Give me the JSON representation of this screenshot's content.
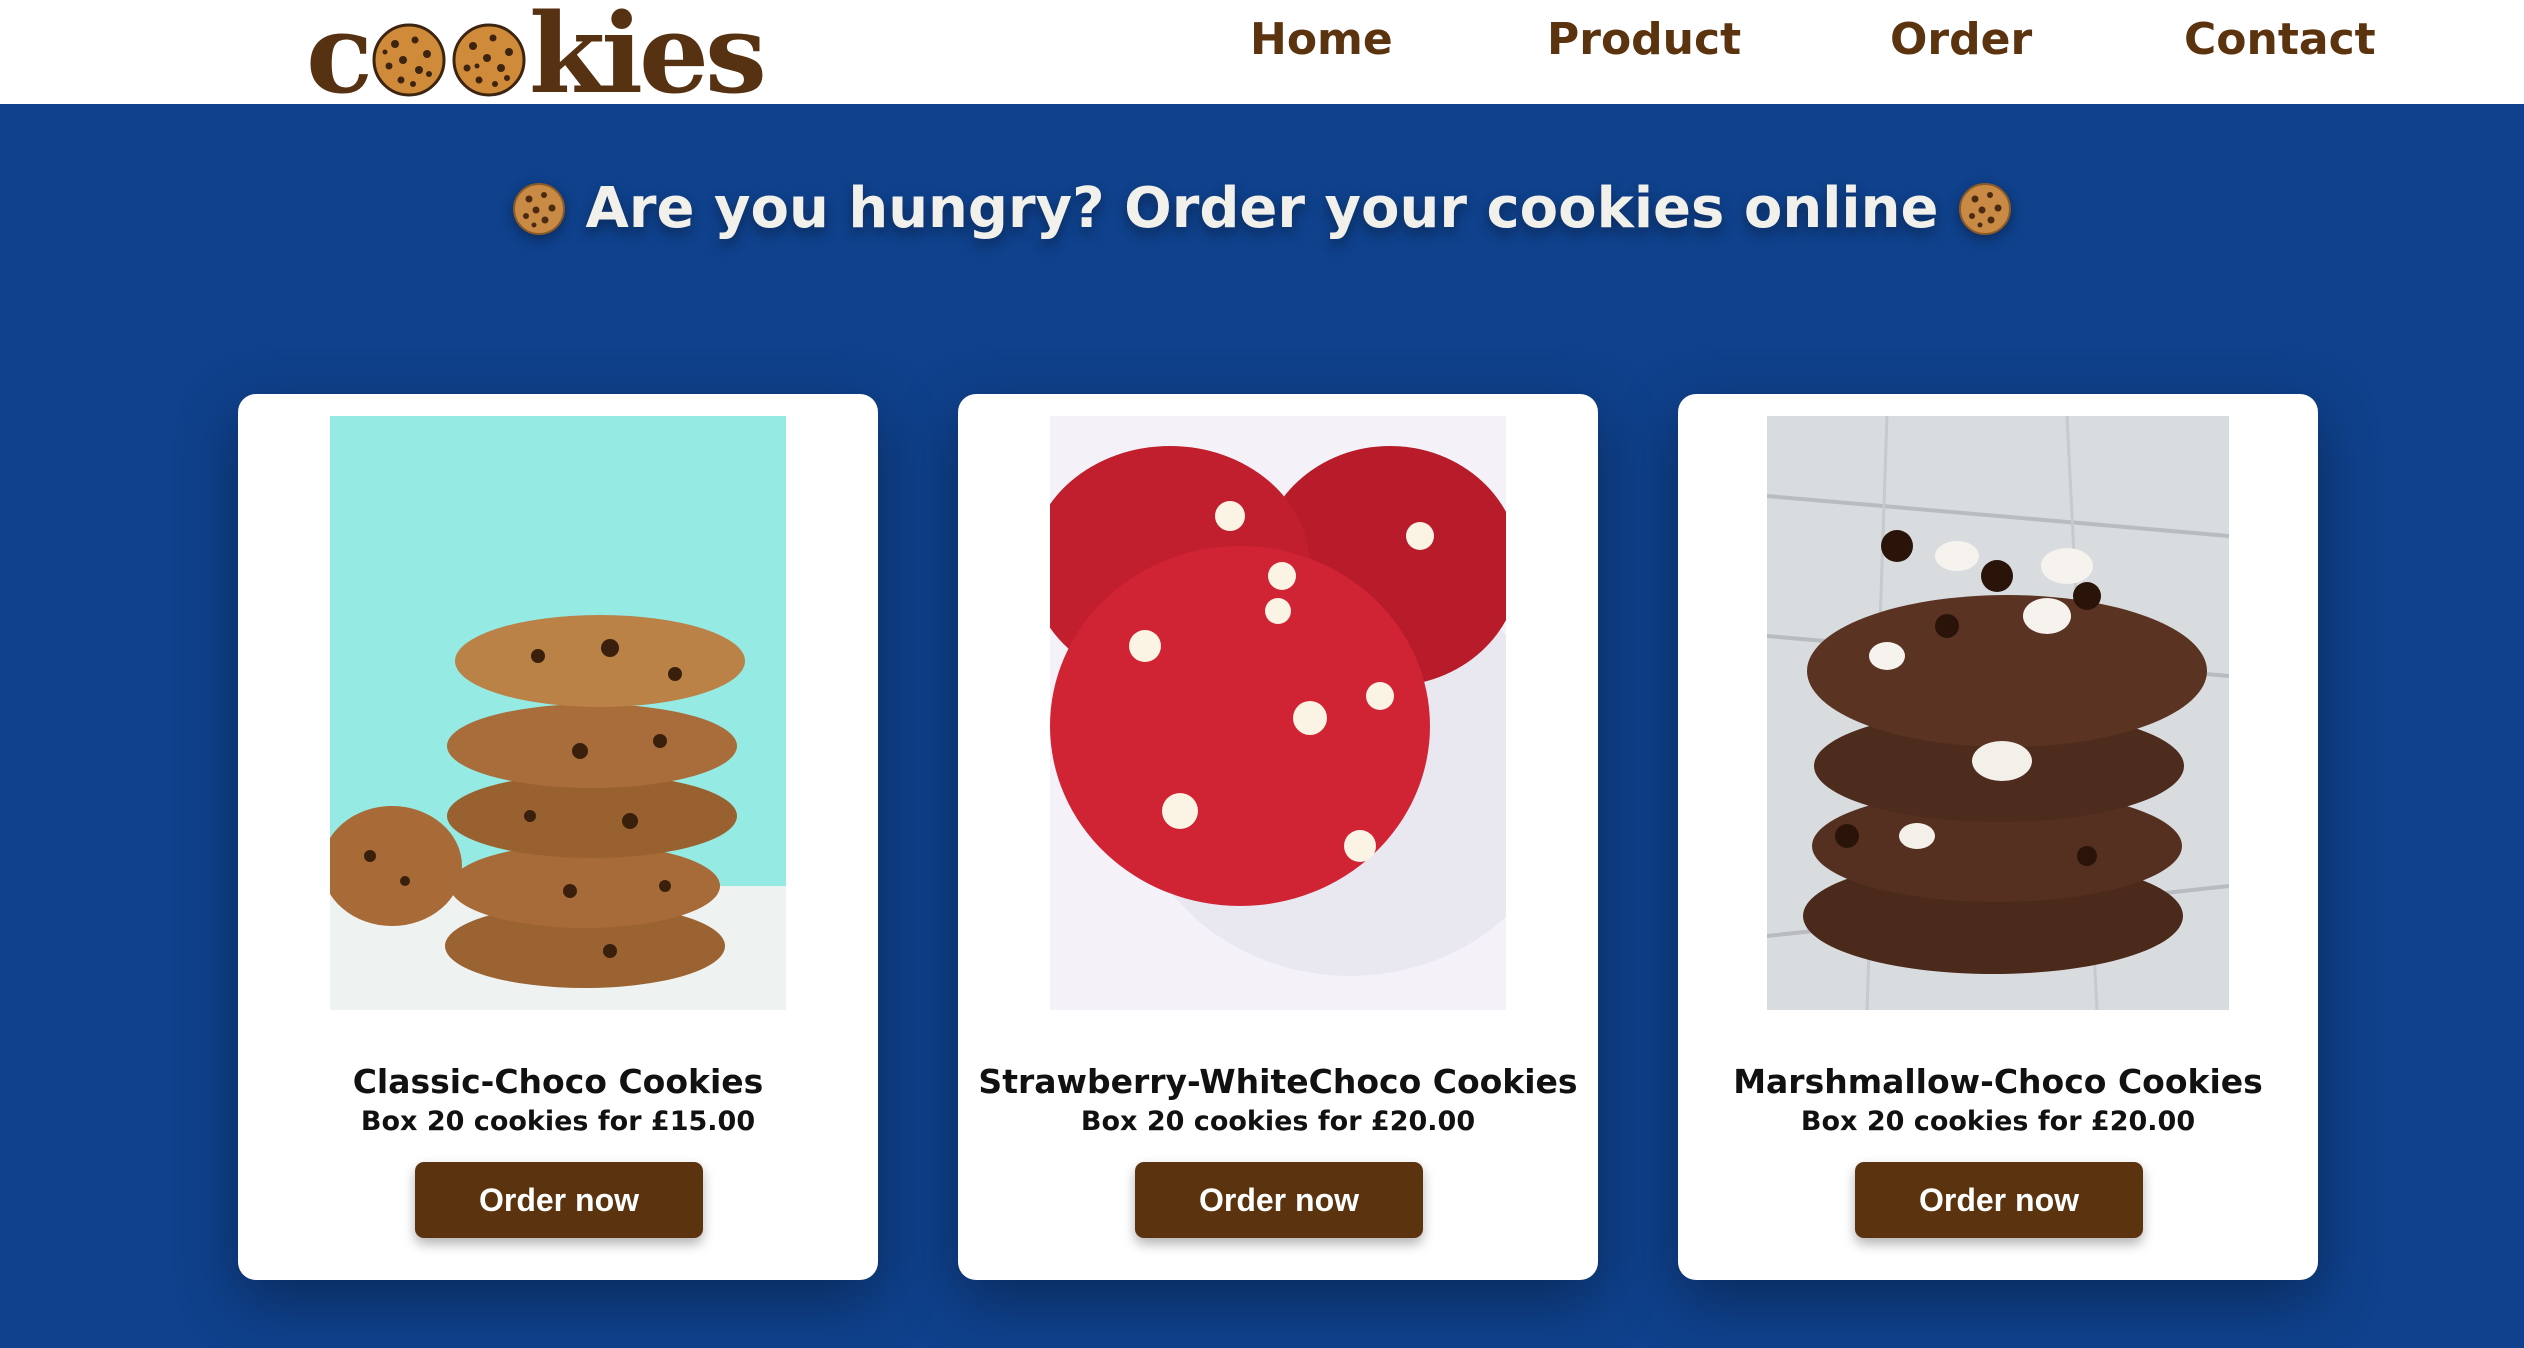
{
  "brand": {
    "logo_text_start": "c",
    "logo_text_end": "kies",
    "color": "#573212"
  },
  "nav": {
    "items": [
      {
        "label": "Home"
      },
      {
        "label": "Product"
      },
      {
        "label": "Order"
      },
      {
        "label": "Contact"
      }
    ],
    "color": "#5b330e"
  },
  "hero": {
    "title": "Are you hungry? Order your cookies online",
    "icon": "cookie-icon"
  },
  "products": [
    {
      "name": "Classic-Choco Cookies",
      "price": "Box 20 cookies for £15.00",
      "button": "Order now",
      "image": "stack-of-chocolate-chip-cookies-photo"
    },
    {
      "name": "Strawberry-WhiteChoco Cookies",
      "price": "Box 20 cookies for £20.00",
      "button": "Order now",
      "image": "red-velvet-white-chocolate-cookies-photo"
    },
    {
      "name": "Marshmallow-Choco Cookies",
      "price": "Box 20 cookies for £20.00",
      "button": "Order now",
      "image": "double-chocolate-marshmallow-cookies-photo"
    }
  ],
  "colors": {
    "background": "#0f418c",
    "button": "#5b330e",
    "card": "#ffffff"
  }
}
